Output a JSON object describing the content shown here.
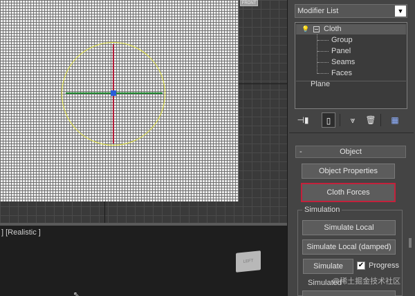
{
  "viewport_top": {
    "viewcube_label": "FRONT"
  },
  "viewport_bottom": {
    "label": "] [Realistic ]",
    "cube_label": "LEFT",
    "cursor": "⇖"
  },
  "command_panel": {
    "modifier_list": {
      "value": "Modifier List",
      "arrow": "▼"
    },
    "stack": {
      "bulb_icon": "💡",
      "cloth": "Cloth",
      "sub_objects": [
        "Group",
        "Panel",
        "Seams",
        "Faces"
      ],
      "base": "Plane"
    },
    "toolbar_icons": {
      "pin": "⊣▮",
      "show_end_result": "▯",
      "make_unique": "⩔",
      "remove_modifier": "🗑",
      "configure_sets": "▦"
    },
    "object_rollout": {
      "collapse": "-",
      "title": "Object",
      "object_properties": "Object Properties",
      "cloth_forces": "Cloth Forces"
    },
    "simulation": {
      "title": "Simulation",
      "simulate_local": "Simulate Local",
      "simulate_local_damped": "Simulate Local (damped)",
      "simulate": "Simulate",
      "progress_checked": true,
      "progress_mark": "✔",
      "progress_label": "Progress",
      "status": "Simulated",
      "partial_button": ""
    }
  },
  "watermark": "@稀土掘金技术社区",
  "colors": {
    "highlight_border": "#c4213b",
    "gizmo_ring": "#e6e640",
    "axis_y": "#b21c38",
    "axis_x": "#1d8a2e"
  }
}
